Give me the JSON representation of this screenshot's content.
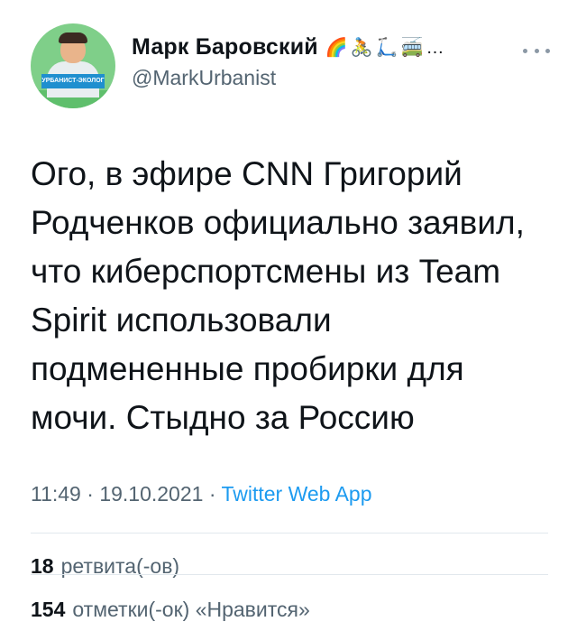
{
  "author": {
    "display_name": "Марк Баровский",
    "emoji": "🌈🚴🛴🚎…",
    "handle": "@MarkUrbanist",
    "avatar_badge": "УРБАНИСТ-ЭКОЛОГ"
  },
  "tweet": {
    "text": "Ого, в эфире CNN Григорий Родченков официально заявил, что киберспортсмены из Team Spirit использовали подмененные пробирки для мочи. Стыдно за Россию",
    "time": "11:49",
    "date": "19.10.2021",
    "separator": " · ",
    "source": "Twitter Web App"
  },
  "stats": {
    "retweets_count": "18",
    "retweets_label": "ретвита(-ов)",
    "likes_count": "154",
    "likes_label": "отметки(-ок) «Нравится»"
  }
}
